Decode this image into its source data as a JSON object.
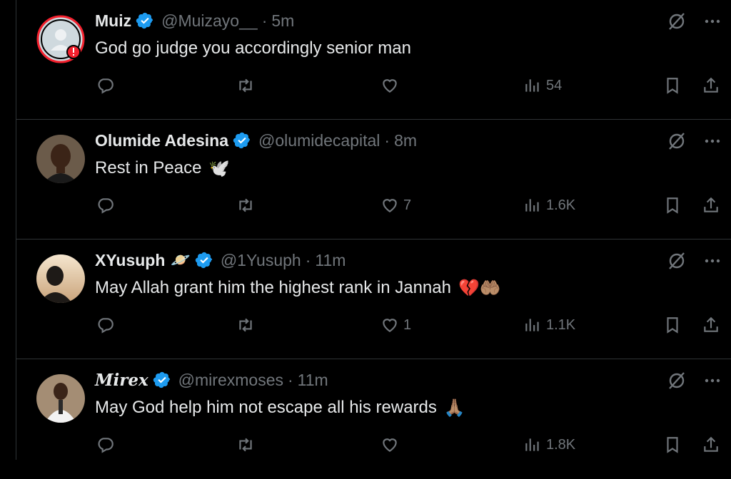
{
  "tweets": [
    {
      "name": "Muiz",
      "handle": "@Muizayo__",
      "separator": "·",
      "time": "5m",
      "text": "God go judge you accordingly senior man",
      "emoji": "",
      "name_emoji": "",
      "replies": "",
      "retweets": "",
      "likes": "",
      "views": "54",
      "avatar": "default-avatar-with-alert"
    },
    {
      "name": "Olumide Adesina",
      "handle": "@olumidecapital",
      "separator": "·",
      "time": "8m",
      "text": "Rest in Peace",
      "emoji": "🕊️",
      "name_emoji": "",
      "replies": "",
      "retweets": "",
      "likes": "7",
      "views": "1.6K",
      "avatar": "photo-man-dark-shirt"
    },
    {
      "name": "XYusuph",
      "handle": "@1Yusuph",
      "separator": "·",
      "time": "11m",
      "text": "May Allah grant him the highest rank in Jannah",
      "emoji": "💔🤲🏽",
      "name_emoji": "🪐",
      "replies": "",
      "retweets": "",
      "likes": "1",
      "views": "1.1K",
      "avatar": "photo-silhouette-sunset"
    },
    {
      "name": "Mirex",
      "handle": "@mirexmoses",
      "separator": "·",
      "time": "11m",
      "text": "May God help him not escape all his rewards",
      "emoji": "🙏🏽",
      "name_emoji": "",
      "replies": "",
      "retweets": "",
      "likes": "",
      "views": "1.8K",
      "avatar": "photo-man-white-outfit"
    }
  ],
  "colors": {
    "background": "#000000",
    "text": "#e7e9ea",
    "muted": "#71767b",
    "verified": "#1d9bf0",
    "divider": "#2f3336",
    "alert": "#f4212e"
  },
  "icons": [
    "reply-icon",
    "retweet-icon",
    "like-icon",
    "views-icon",
    "bookmark-icon",
    "share-icon",
    "grok-icon",
    "more-icon",
    "verified-icon"
  ]
}
